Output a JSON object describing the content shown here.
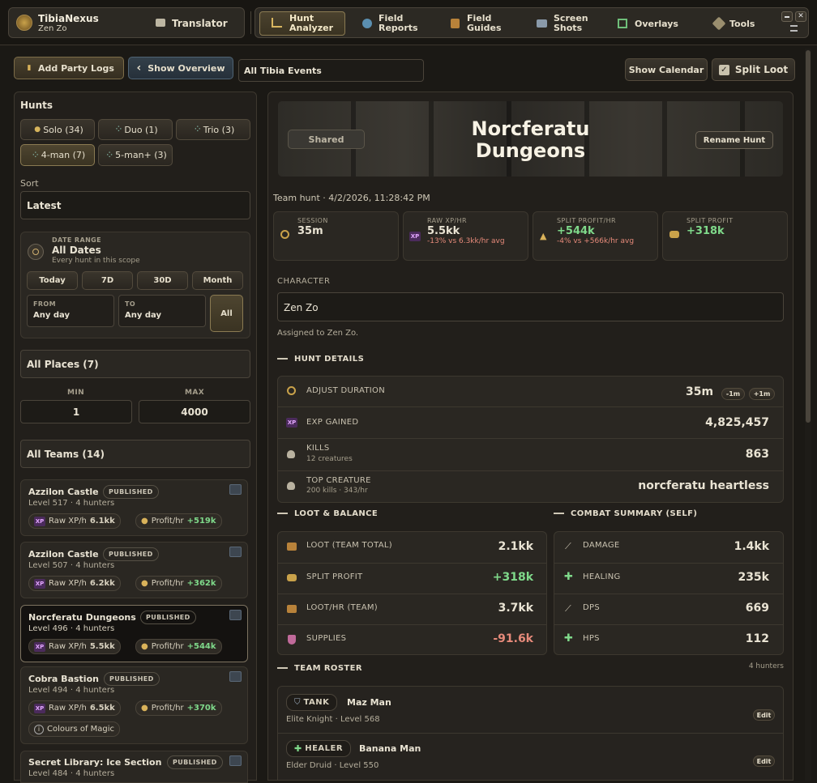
{
  "app": {
    "name": "TibiaNexus",
    "user": "Zen Zo"
  },
  "nav": {
    "translator": "Translator",
    "hunt_analyzer": "Hunt\nAnalyzer",
    "field_reports": "Field\nReports",
    "field_guides": "Field\nGuides",
    "screen_shots": "Screen\nShots",
    "overlays": "Overlays",
    "tools": "Tools"
  },
  "toolbar": {
    "add_party_logs": "Add Party Logs",
    "show_overview": "Show Overview",
    "events_value": "All Tibia Events",
    "show_calendar": "Show Calendar",
    "split_loot": "Split Loot"
  },
  "sidebar": {
    "hunts_title": "Hunts",
    "filters": [
      {
        "label": "Solo (34)"
      },
      {
        "label": "Duo (1)"
      },
      {
        "label": "Trio (3)"
      },
      {
        "label": "4-man (7)"
      },
      {
        "label": "5-man+ (3)"
      }
    ],
    "sort_label": "Sort",
    "sort_value": "Latest",
    "date_range_label": "DATE RANGE",
    "date_range_value": "All Dates",
    "date_range_sub": "Every hunt in this scope",
    "quick": [
      "Today",
      "7D",
      "30D",
      "Month"
    ],
    "from_label": "FROM",
    "from_value": "Any day",
    "to_label": "TO",
    "to_value": "Any day",
    "all_button": "All",
    "places": "All Places (7)",
    "min_label": "MIN",
    "max_label": "MAX",
    "min_value": "1",
    "max_value": "4000",
    "teams": "All Teams (14)",
    "xp_label": "Raw XP/h",
    "profit_label": "Profit/hr",
    "hunts": [
      {
        "name": "Azzilon Castle",
        "status": "PUBLISHED",
        "level": "Level 517 · 4 hunters",
        "xp": "6.1kk",
        "profit": "+519k"
      },
      {
        "name": "Azzilon Castle",
        "status": "PUBLISHED",
        "level": "Level 507 · 4 hunters",
        "xp": "6.2kk",
        "profit": "+362k"
      },
      {
        "name": "Norcferatu Dungeons",
        "status": "PUBLISHED",
        "level": "Level 496 · 4 hunters",
        "xp": "5.5kk",
        "profit": "+544k"
      },
      {
        "name": "Cobra Bastion",
        "status": "PUBLISHED",
        "level": "Level 494 · 4 hunters",
        "xp": "6.5kk",
        "profit": "+370k",
        "tag": "Colours of Magic"
      },
      {
        "name": "Secret Library: Ice Section",
        "status": "PUBLISHED",
        "level": "Level 484 · 4 hunters"
      }
    ]
  },
  "detail": {
    "shared": "Shared",
    "title_line1": "Norcferatu",
    "title_line2": "Dungeons",
    "rename": "Rename Hunt",
    "meta": "Team hunt · 4/2/2026, 11:28:42 PM",
    "stats": [
      {
        "label": "SESSION",
        "value": "35m",
        "sub": ""
      },
      {
        "label": "RAW XP/HR",
        "value": "5.5kk",
        "sub": "-13% vs 6.3kk/hr avg"
      },
      {
        "label": "SPLIT PROFIT/HR",
        "value": "+544k",
        "sub": "-4% vs +566k/hr avg"
      },
      {
        "label": "SPLIT PROFIT",
        "value": "+318k",
        "sub": ""
      }
    ],
    "character_label": "CHARACTER",
    "character_value": "Zen Zo",
    "assigned": "Assigned to Zen Zo.",
    "hunt_details_title": "HUNT DETAILS",
    "adjust_duration": "ADJUST DURATION",
    "duration_value": "35m",
    "minus": "-1m",
    "plus": "+1m",
    "exp_gained": "EXP GAINED",
    "exp_value": "4,825,457",
    "kills": "KILLS",
    "kills_sub": "12 creatures",
    "kills_value": "863",
    "top_creature": "TOP CREATURE",
    "top_sub": "200 kills · 343/hr",
    "top_value": "norcferatu heartless",
    "loot_title": "LOOT & BALANCE",
    "loot": [
      {
        "label": "LOOT (TEAM TOTAL)",
        "value": "2.1kk"
      },
      {
        "label": "SPLIT PROFIT",
        "value": "+318k"
      },
      {
        "label": "LOOT/HR (TEAM)",
        "value": "3.7kk"
      },
      {
        "label": "SUPPLIES",
        "value": "-91.6k"
      }
    ],
    "combat_title": "COMBAT SUMMARY (SELF)",
    "combat": [
      {
        "label": "DAMAGE",
        "value": "1.4kk"
      },
      {
        "label": "HEALING",
        "value": "235k"
      },
      {
        "label": "DPS",
        "value": "669"
      },
      {
        "label": "HPS",
        "value": "112"
      }
    ],
    "roster_title": "TEAM ROSTER",
    "roster_count": "4 hunters",
    "roster": [
      {
        "role": "TANK",
        "name": "Maz Man",
        "voc": "Elite Knight · Level 568",
        "edit": "Edit"
      },
      {
        "role": "HEALER",
        "name": "Banana Man",
        "voc": "Elder Druid · Level 550",
        "edit": "Edit"
      }
    ]
  }
}
